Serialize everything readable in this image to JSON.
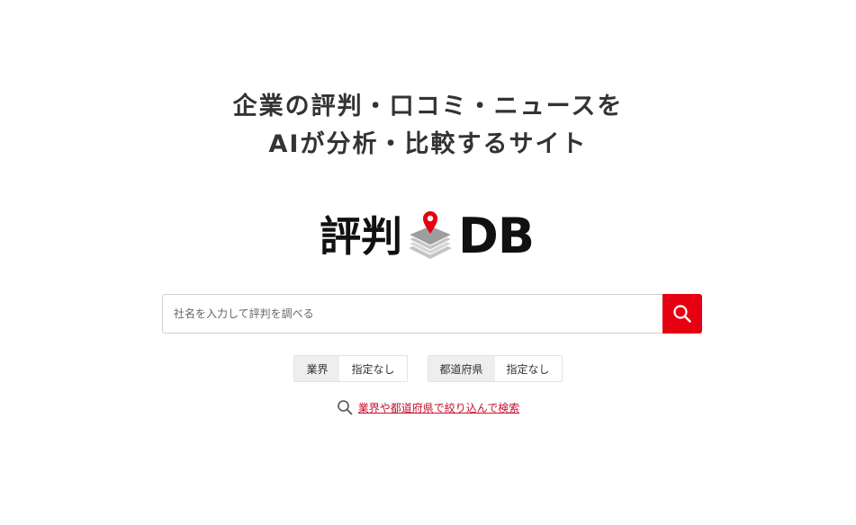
{
  "hero": {
    "tagline_line1": "企業の評判・口コミ・ニュースを",
    "tagline_line2": "AIが分析・比較するサイト"
  },
  "logo": {
    "text_jp": "評判",
    "text_en": "DB",
    "pin_color": "#e60012"
  },
  "search": {
    "placeholder": "社名を入力して評判を調べる",
    "value": "",
    "button_icon": "search-icon",
    "button_color": "#e60012"
  },
  "filters": [
    {
      "label": "業界",
      "value": "指定なし"
    },
    {
      "label": "都道府県",
      "value": "指定なし"
    }
  ],
  "refine": {
    "icon": "search-icon",
    "link_text": "業界や都道府県で絞り込んで検索",
    "link_color": "#c8102e"
  }
}
